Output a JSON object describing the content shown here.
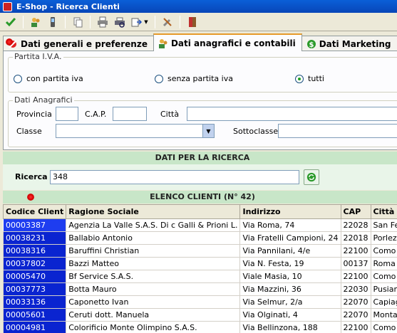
{
  "window": {
    "title": "E-Shop - Ricerca Clienti"
  },
  "toolbar": {
    "buttons": [
      "confirm-icon",
      "users-icon",
      "mobile-icon",
      "copy-icon",
      "print-icon",
      "print-preview-icon",
      "export-icon",
      "tools-icon",
      "exit-icon"
    ]
  },
  "tabs": [
    {
      "label": "Dati generali e preferenze",
      "active": false
    },
    {
      "label": "Dati anagrafici e contabili",
      "active": true
    },
    {
      "label": "Dati Marketing",
      "active": false
    }
  ],
  "partita_iva": {
    "legend": "Partita I.V.A.",
    "options": [
      {
        "label": "con partita iva",
        "checked": false
      },
      {
        "label": "senza partita iva",
        "checked": false
      },
      {
        "label": "tutti",
        "checked": true
      }
    ]
  },
  "anagrafici": {
    "legend": "Dati Anagrafici",
    "provincia_label": "Provincia",
    "provincia_value": "",
    "cap_label": "C.A.P.",
    "cap_value": "",
    "citta_label": "Città",
    "citta_value": "",
    "classe_label": "Classe",
    "classe_value": "",
    "sottoclasse_label": "Sottoclasse",
    "sottoclasse_value": ""
  },
  "search": {
    "header": "DATI PER LA RICERCA",
    "label": "Ricerca",
    "value": "348"
  },
  "list": {
    "header": "ELENCO CLIENTI (N° 42)",
    "columns": [
      "Codice Client",
      "Ragione Sociale",
      "Indirizzo",
      "CAP",
      "Città"
    ],
    "rows": [
      [
        "00003387",
        "Agenzia La Valle S.A.S. Di c Galli & Prioni L.",
        "Via Roma, 74",
        "22028",
        "San Fed"
      ],
      [
        "00038231",
        "Ballabio Antonio",
        "Via Fratelli Campioni, 24",
        "22018",
        "Porlezz"
      ],
      [
        "00038316",
        "Baruffini Christian",
        "Via Pannilani, 4/e",
        "22100",
        "Como"
      ],
      [
        "00037802",
        "Bazzi Matteo",
        "Via N. Festa, 19",
        "00137",
        "Roma"
      ],
      [
        "00005470",
        "Bf Service S.A.S.",
        "Viale Masia, 10",
        "22100",
        "Como"
      ],
      [
        "00037773",
        "Botta Mauro",
        "Via Mazzini, 36",
        "22030",
        "Pusiano"
      ],
      [
        "00033136",
        "Caponetto Ivan",
        "Via Selmur, 2/a",
        "22070",
        "Capiago"
      ],
      [
        "00005601",
        "Ceruti dott. Manuela",
        "Via Olginati, 4",
        "22070",
        "Montan"
      ],
      [
        "00004981",
        "Colorificio Monte Olimpino S.A.S.",
        "Via Bellinzona, 188",
        "22100",
        "Como"
      ]
    ]
  }
}
